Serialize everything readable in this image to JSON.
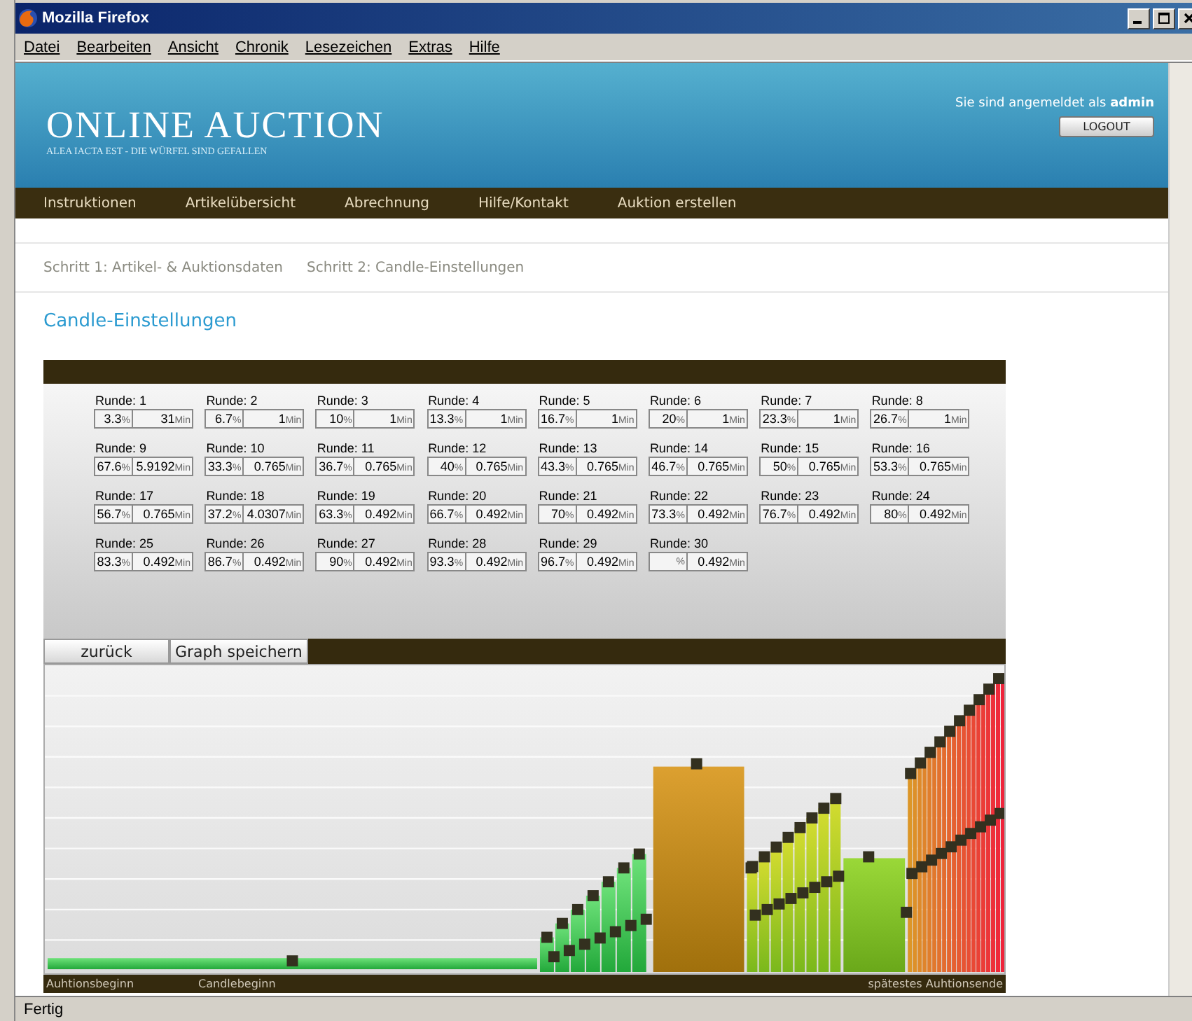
{
  "window": {
    "title": "Mozilla Firefox"
  },
  "menu_bar": [
    "Datei",
    "Bearbeiten",
    "Ansicht",
    "Chronik",
    "Lesezeichen",
    "Extras",
    "Hilfe"
  ],
  "header": {
    "logo": "ONLINE AUCTION",
    "tagline": "ALEA IACTA EST - DIE WÜRFEL SIND GEFALLEN",
    "login_text": "Sie sind angemeldet als",
    "user": "admin",
    "logout": "LOGOUT"
  },
  "nav": [
    "Instruktionen",
    "Artikelübersicht",
    "Abrechnung",
    "Hilfe/Kontakt",
    "Auktion erstellen"
  ],
  "steps": [
    "Schritt 1: Artikel- & Auktionsdaten",
    "Schritt 2: Candle-Einstellungen"
  ],
  "heading": "Candle-Einstellungen",
  "rounds": [
    {
      "label": "Runde: 1",
      "percent": "3.3",
      "percent_unit": "%",
      "minutes": "31",
      "minutes_unit": "Min"
    },
    {
      "label": "Runde: 2",
      "percent": "6.7",
      "percent_unit": "%",
      "minutes": "1",
      "minutes_unit": "Min"
    },
    {
      "label": "Runde: 3",
      "percent": "10",
      "percent_unit": "%",
      "minutes": "1",
      "minutes_unit": "Min"
    },
    {
      "label": "Runde: 4",
      "percent": "13.3",
      "percent_unit": "%",
      "minutes": "1",
      "minutes_unit": "Min"
    },
    {
      "label": "Runde: 5",
      "percent": "16.7",
      "percent_unit": "%",
      "minutes": "1",
      "minutes_unit": "Min"
    },
    {
      "label": "Runde: 6",
      "percent": "20",
      "percent_unit": "%",
      "minutes": "1",
      "minutes_unit": "Min"
    },
    {
      "label": "Runde: 7",
      "percent": "23.3",
      "percent_unit": "%",
      "minutes": "1",
      "minutes_unit": "Min"
    },
    {
      "label": "Runde: 8",
      "percent": "26.7",
      "percent_unit": "%",
      "minutes": "1",
      "minutes_unit": "Min"
    },
    {
      "label": "Runde: 9",
      "percent": "67.6",
      "percent_unit": "%",
      "minutes": "5.9192",
      "minutes_unit": "Min"
    },
    {
      "label": "Runde: 10",
      "percent": "33.3",
      "percent_unit": "%",
      "minutes": "0.765",
      "minutes_unit": "Min"
    },
    {
      "label": "Runde: 11",
      "percent": "36.7",
      "percent_unit": "%",
      "minutes": "0.765",
      "minutes_unit": "Min"
    },
    {
      "label": "Runde: 12",
      "percent": "40",
      "percent_unit": "%",
      "minutes": "0.765",
      "minutes_unit": "Min"
    },
    {
      "label": "Runde: 13",
      "percent": "43.3",
      "percent_unit": "%",
      "minutes": "0.765",
      "minutes_unit": "Min"
    },
    {
      "label": "Runde: 14",
      "percent": "46.7",
      "percent_unit": "%",
      "minutes": "0.765",
      "minutes_unit": "Min"
    },
    {
      "label": "Runde: 15",
      "percent": "50",
      "percent_unit": "%",
      "minutes": "0.765",
      "minutes_unit": "Min"
    },
    {
      "label": "Runde: 16",
      "percent": "53.3",
      "percent_unit": "%",
      "minutes": "0.765",
      "minutes_unit": "Min"
    },
    {
      "label": "Runde: 17",
      "percent": "56.7",
      "percent_unit": "%",
      "minutes": "0.765",
      "minutes_unit": "Min"
    },
    {
      "label": "Runde: 18",
      "percent": "37.2",
      "percent_unit": "%",
      "minutes": "4.0307",
      "minutes_unit": "Min"
    },
    {
      "label": "Runde: 19",
      "percent": "63.3",
      "percent_unit": "%",
      "minutes": "0.492",
      "minutes_unit": "Min"
    },
    {
      "label": "Runde: 20",
      "percent": "66.7",
      "percent_unit": "%",
      "minutes": "0.492",
      "minutes_unit": "Min"
    },
    {
      "label": "Runde: 21",
      "percent": "70",
      "percent_unit": "%",
      "minutes": "0.492",
      "minutes_unit": "Min"
    },
    {
      "label": "Runde: 22",
      "percent": "73.3",
      "percent_unit": "%",
      "minutes": "0.492",
      "minutes_unit": "Min"
    },
    {
      "label": "Runde: 23",
      "percent": "76.7",
      "percent_unit": "%",
      "minutes": "0.492",
      "minutes_unit": "Min"
    },
    {
      "label": "Runde: 24",
      "percent": "80",
      "percent_unit": "%",
      "minutes": "0.492",
      "minutes_unit": "Min"
    },
    {
      "label": "Runde: 25",
      "percent": "83.3",
      "percent_unit": "%",
      "minutes": "0.492",
      "minutes_unit": "Min"
    },
    {
      "label": "Runde: 26",
      "percent": "86.7",
      "percent_unit": "%",
      "minutes": "0.492",
      "minutes_unit": "Min"
    },
    {
      "label": "Runde: 27",
      "percent": "90",
      "percent_unit": "%",
      "minutes": "0.492",
      "minutes_unit": "Min"
    },
    {
      "label": "Runde: 28",
      "percent": "93.3",
      "percent_unit": "%",
      "minutes": "0.492",
      "minutes_unit": "Min"
    },
    {
      "label": "Runde: 29",
      "percent": "96.7",
      "percent_unit": "%",
      "minutes": "0.492",
      "minutes_unit": "Min"
    },
    {
      "label": "Runde: 30",
      "percent_unit": "%",
      "minutes": "0.492",
      "minutes_unit": "Min"
    }
  ],
  "buttons": [
    "zurück",
    "Graph speichern"
  ],
  "graph_labels": {
    "start": "Auhtionsbeginn",
    "candle": "Candlebeginn",
    "end": "spätestes Auhtionsende"
  },
  "status_bar": "Fertig"
}
